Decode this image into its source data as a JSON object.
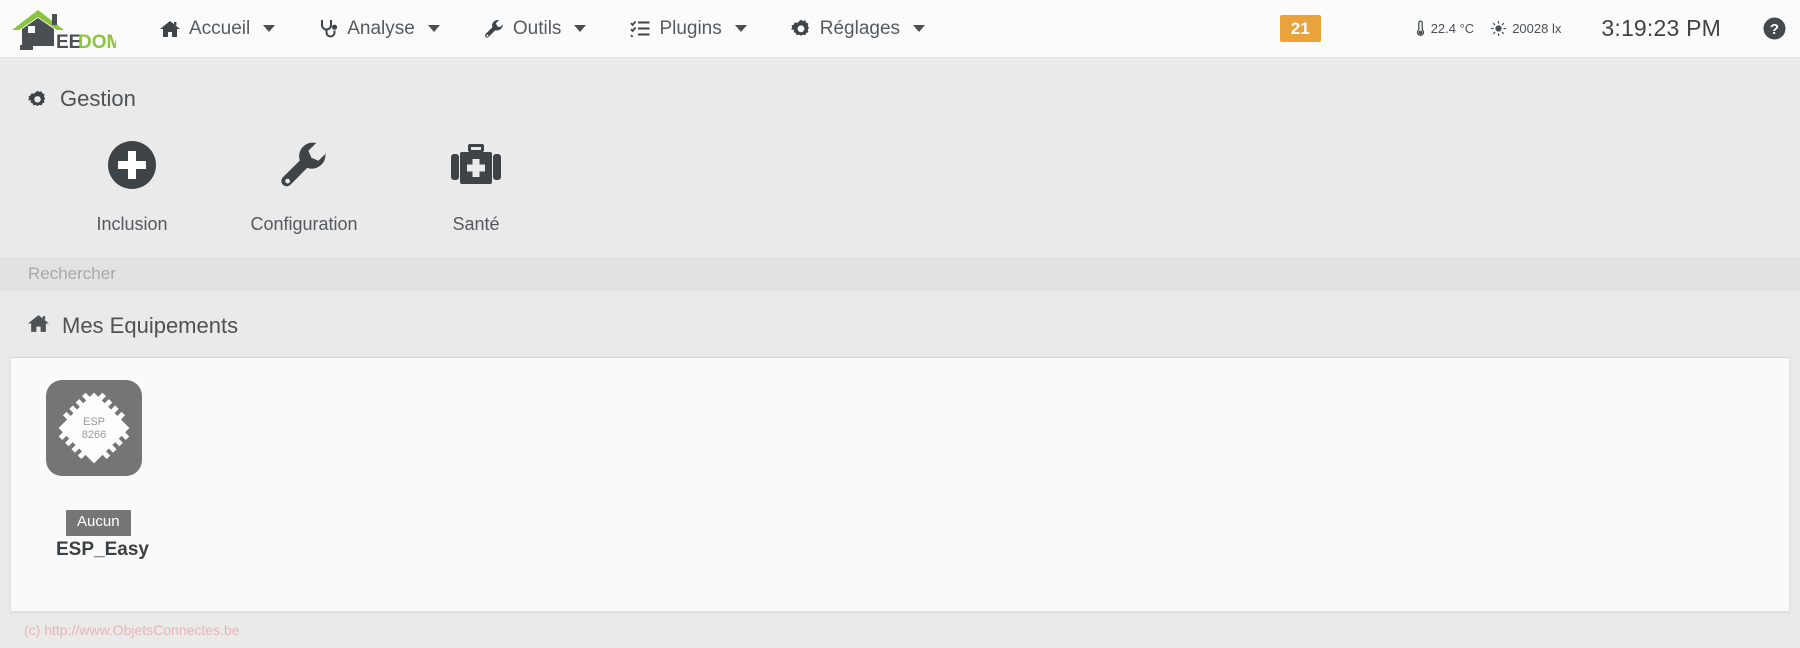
{
  "app": {
    "brand_name_dark": "EE",
    "brand_name_accent": "DOM",
    "brand_accent_color": "#8bc53f"
  },
  "topnav": {
    "items": [
      {
        "label": "Accueil",
        "icon": "home-icon"
      },
      {
        "label": "Analyse",
        "icon": "stethoscope-icon"
      },
      {
        "label": "Outils",
        "icon": "wrench-icon"
      },
      {
        "label": "Plugins",
        "icon": "list-check-icon"
      },
      {
        "label": "Réglages",
        "icon": "gear-icon"
      }
    ],
    "badge_count": "21",
    "badge_color": "#e8a33d",
    "sensors": [
      {
        "icon": "thermometer-icon",
        "value": "22.4 °C"
      },
      {
        "icon": "sun-icon",
        "value": "20028 lx"
      }
    ],
    "clock": "3:19:23 PM",
    "help_icon": "question-circle-icon"
  },
  "gestion": {
    "title": "Gestion",
    "title_icon": "gear-icon",
    "actions": [
      {
        "label": "Inclusion",
        "icon": "plus-circle-icon"
      },
      {
        "label": "Configuration",
        "icon": "wrench-icon"
      },
      {
        "label": "Santé",
        "icon": "medkit-icon"
      }
    ]
  },
  "search": {
    "placeholder": "Rechercher",
    "value": ""
  },
  "equipments": {
    "title": "Mes Equipements",
    "title_icon": "home-icon",
    "devices": [
      {
        "name": "ESP_Easy",
        "badge": "Aucun",
        "thumb_label_line1": "ESP",
        "thumb_label_line2": "8266"
      }
    ]
  },
  "footer": {
    "copyright": "(c) http://www.ObjetsConnectes.be"
  }
}
